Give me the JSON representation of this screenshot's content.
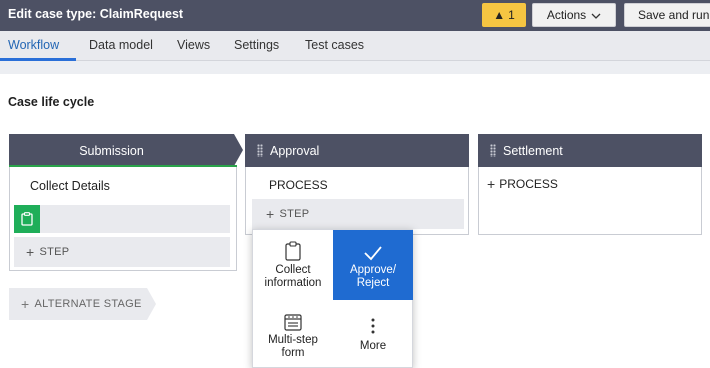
{
  "header": {
    "title": "Edit case type: ClaimRequest",
    "warning_count": "1",
    "actions_label": "Actions",
    "save_label": "Save and run"
  },
  "tabs": [
    {
      "label": "Workflow",
      "active": true
    },
    {
      "label": "Data model"
    },
    {
      "label": "Views"
    },
    {
      "label": "Settings"
    },
    {
      "label": "Test cases"
    }
  ],
  "section_title": "Case life cycle",
  "stages": {
    "submission": {
      "name": "Submission",
      "process": "Collect Details",
      "step_label": "STEP"
    },
    "approval": {
      "name": "Approval",
      "process": "PROCESS",
      "step_label": "STEP"
    },
    "settlement": {
      "name": "Settlement",
      "process": "PROCESS"
    }
  },
  "alternate_stage_label": "ALTERNATE STAGE",
  "step_menu": {
    "collect": [
      "Collect",
      "information"
    ],
    "approve": [
      "Approve/",
      "Reject"
    ],
    "multistep": [
      "Multi-step",
      "form"
    ],
    "more": "More"
  },
  "colors": {
    "header_bg": "#4d5164",
    "accent_blue": "#1f6bd1",
    "active_green": "#2aa34a",
    "warning_yellow": "#f5c542"
  }
}
